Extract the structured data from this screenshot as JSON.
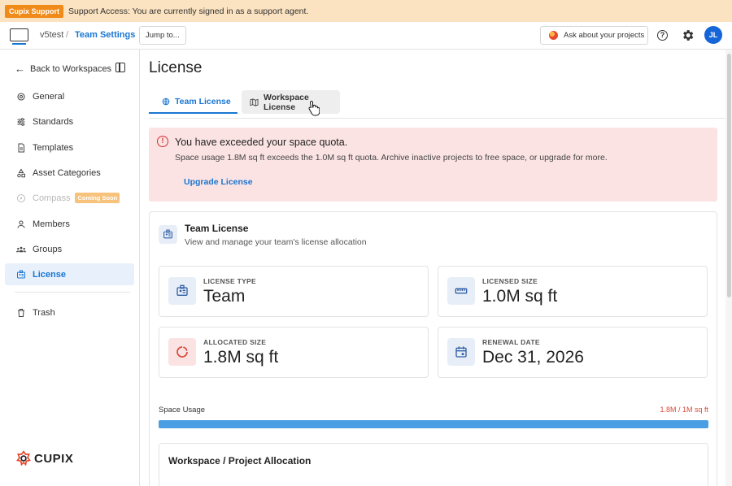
{
  "banner": {
    "badge": "Cupix Support",
    "text": "Support Access: You are currently signed in as a support agent."
  },
  "header": {
    "breadcrumb": {
      "workspace": "v5test",
      "separator": "/",
      "current": "Team Settings"
    },
    "jump_label": "Jump to...",
    "ask_label": "Ask about your projects",
    "help_glyph": "?",
    "avatar_initials": "JL"
  },
  "sidebar": {
    "back_label": "Back to Workspaces",
    "items": [
      {
        "label": "General",
        "icon": "gear-icon"
      },
      {
        "label": "Standards",
        "icon": "sliders-icon"
      },
      {
        "label": "Templates",
        "icon": "document-icon"
      },
      {
        "label": "Asset Categories",
        "icon": "shapes-icon"
      },
      {
        "label": "Compass",
        "icon": "compass-icon",
        "badge": "Coming Soon",
        "disabled": true
      },
      {
        "label": "Members",
        "icon": "person-icon"
      },
      {
        "label": "Groups",
        "icon": "group-icon"
      },
      {
        "label": "License",
        "icon": "id-card-icon",
        "active": true
      },
      {
        "label": "Trash",
        "icon": "trash-icon"
      }
    ],
    "brand": "CUPIX"
  },
  "main": {
    "title": "License",
    "tabs": [
      {
        "label": "Team License",
        "active": true
      },
      {
        "label": "Workspace License",
        "active": false
      }
    ],
    "alert": {
      "title": "You have exceeded your space quota.",
      "description": "Space usage 1.8M sq ft exceeds the 1.0M sq ft quota. Archive inactive projects to free space, or upgrade for more.",
      "action": "Upgrade License"
    },
    "card": {
      "title": "Team License",
      "subtitle": "View and manage your team's license allocation",
      "stats": [
        {
          "label": "LICENSE TYPE",
          "value": "Team"
        },
        {
          "label": "LICENSED SIZE",
          "value": "1.0M sq ft"
        },
        {
          "label": "ALLOCATED SIZE",
          "value": "1.8M sq ft"
        },
        {
          "label": "RENEWAL DATE",
          "value": "Dec 31, 2026"
        }
      ],
      "usage": {
        "label": "Space Usage",
        "value_text": "1.8M / 1M sq ft",
        "fill_percent": 100
      },
      "allocation_title": "Workspace / Project Allocation"
    }
  },
  "colors": {
    "accent": "#1976d2",
    "banner_bg": "#fbe2c0",
    "alert_bg": "#fbe3e3",
    "error": "#d32f2f",
    "usage_bar": "#4a9ee4"
  }
}
